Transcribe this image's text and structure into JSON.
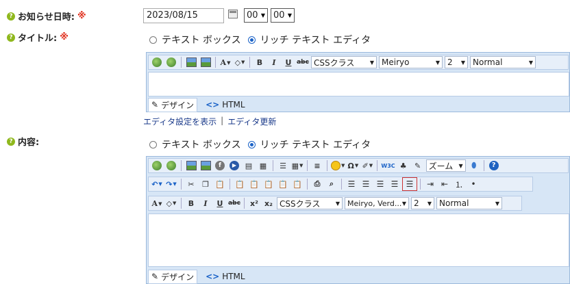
{
  "fields": {
    "date": {
      "label": "お知らせ日時:",
      "required": "※",
      "value": "2023/08/15",
      "hour": "00",
      "minute": "00"
    },
    "title": {
      "label": "タイトル:",
      "required": "※"
    },
    "content": {
      "label": "内容:"
    }
  },
  "help_glyph": "?",
  "radio": {
    "textbox": "テキスト ボックス",
    "richtext": "リッチ テキスト エディタ"
  },
  "toolbar": {
    "bold": "B",
    "italic": "I",
    "underline": "U",
    "strike": "abc",
    "font_color": "A",
    "superscript": "x²",
    "subscript": "x₂",
    "css_class": "CSSクラス",
    "font_name_1": "Meiryo",
    "font_name_2": "Meiryo, Verd...",
    "font_size": "2",
    "format": "Normal",
    "zoom": "ズーム",
    "spell": "W3C",
    "omega": "Ω",
    "help": "?",
    "flash": "f",
    "media": "▶"
  },
  "modes": {
    "design": "デザイン",
    "html": "HTML"
  },
  "links": {
    "show_settings": "エディタ設定を表示",
    "separator": "|",
    "update": "エディタ更新"
  },
  "icons": {
    "link": "link-icon",
    "image": "image-icon",
    "smile": "smiley-icon",
    "help": "help-icon"
  }
}
